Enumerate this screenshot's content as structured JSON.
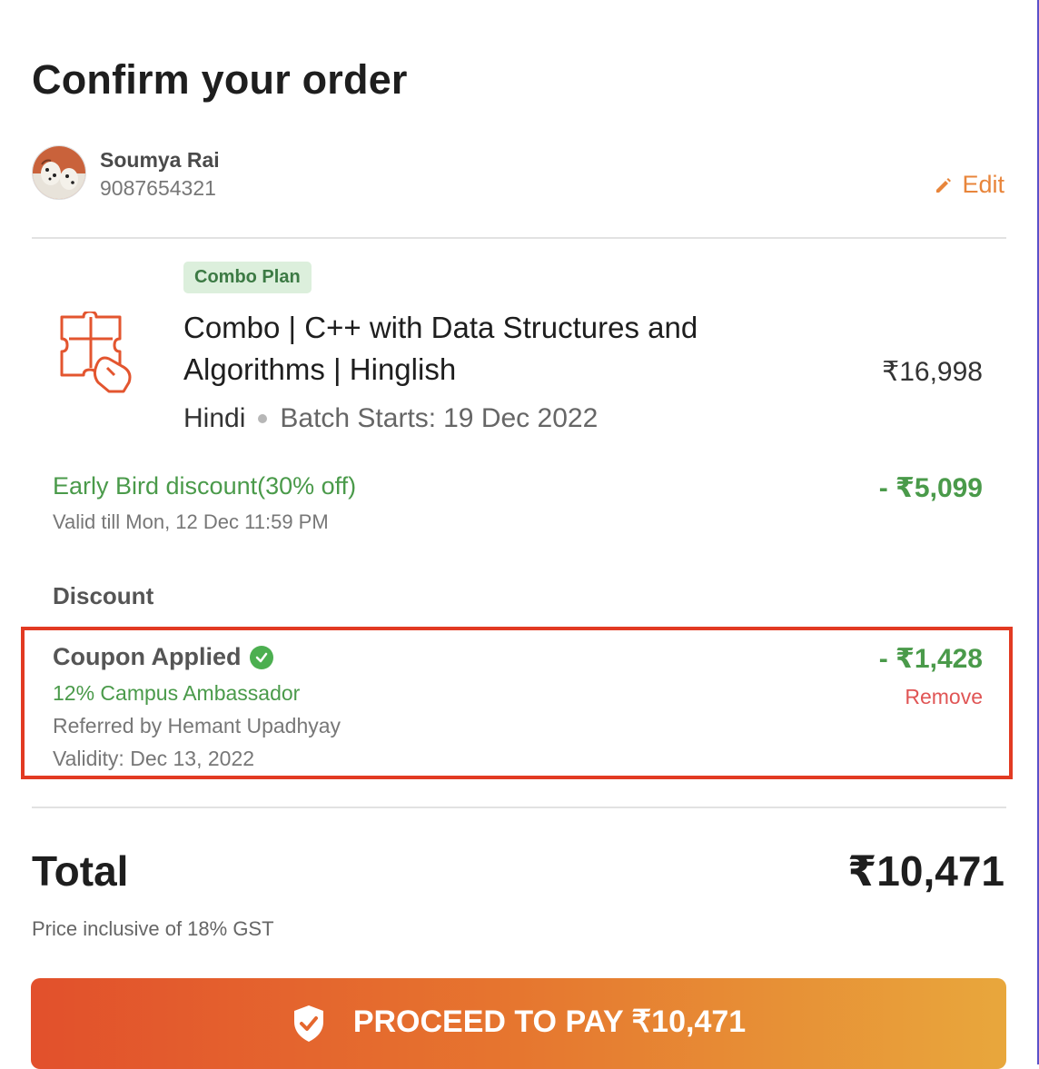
{
  "page": {
    "title": "Confirm your order"
  },
  "user": {
    "name": "Soumya Rai",
    "phone": "9087654321",
    "edit_label": "Edit"
  },
  "product": {
    "badge": "Combo Plan",
    "title": "Combo | C++ with Data Structures and Algorithms | Hinglish",
    "price": "₹16,998",
    "language": "Hindi",
    "batch_label": "Batch Starts:",
    "batch_date": "19 Dec 2022"
  },
  "early_bird": {
    "label": "Early Bird discount(30% off)",
    "amount": "- ₹5,099",
    "valid_till": "Valid till Mon, 12 Dec 11:59 PM"
  },
  "discount": {
    "heading": "Discount",
    "coupon_title": "Coupon Applied",
    "coupon_name": "12% Campus Ambassador",
    "referred_by": "Referred by Hemant Upadhyay",
    "validity": "Validity: Dec 13, 2022",
    "amount": "- ₹1,428",
    "remove_label": "Remove"
  },
  "total": {
    "label": "Total",
    "amount": "₹10,471",
    "gst_note": "Price inclusive of 18% GST"
  },
  "pay_button": {
    "label": "PROCEED TO PAY ₹10,471"
  },
  "colors": {
    "accent_orange": "#e8853b",
    "discount_green": "#4a9a4a",
    "remove_red": "#e05555",
    "highlight_red": "#e23a22"
  },
  "icons": {
    "edit": "pencil-icon",
    "product": "puzzle-icon",
    "coupon_status": "check-circle-icon",
    "pay": "shield-check-icon"
  }
}
